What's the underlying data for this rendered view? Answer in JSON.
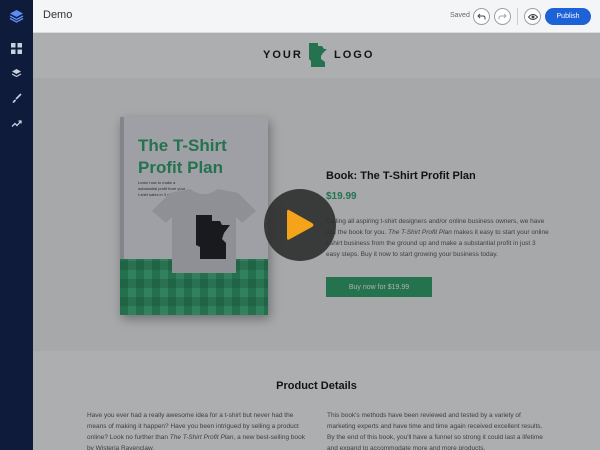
{
  "topbar": {
    "title": "Demo",
    "saved": "Saved",
    "publish": "Publish"
  },
  "rail": {
    "items": [
      {
        "icon": "grid-icon"
      },
      {
        "icon": "layers-icon"
      },
      {
        "icon": "brush-icon"
      },
      {
        "icon": "trend-icon"
      }
    ]
  },
  "brand": {
    "left": "YOUR",
    "right": "LOGO"
  },
  "product": {
    "title": "Book: The T-Shirt Profit Plan",
    "price": "$19.99",
    "description_1": "Calling all aspiring t-shirt designers and/or online business owners, we have just the book for you.",
    "description_em": "The T-Shirt Profit Plan",
    "description_2": "makes it easy to start your online t-shirt business from the ground up and make a substantial profit in just 3 easy steps. Buy it now to start growing your business today.",
    "buy_button": "Buy now for $19.99"
  },
  "book_cover": {
    "title_line1": "The T-Shirt",
    "title_line2": "Profit Plan",
    "subtitle_line1": "Learn how to make a",
    "subtitle_line2": "substantial profit from your",
    "subtitle_line3": "t-shirt sales in 3 easy steps"
  },
  "details": {
    "title": "Product Details",
    "left_1": "Have you ever had a really awesome idea for a t-shirt but never had the means of making it happen? Have you been intrigued by selling a product online? Look no further than",
    "left_em": "The T-Shirt Profit Plan",
    "left_2": ", a new best-selling book by Wisteria Ravenclaw.",
    "right": "This book's methods have been reviewed and tested by a variety of marketing experts and have time and time again received excellent results. By the end of this book, you'll have a funnel so strong it could last a lifetime and expand to accommodate more and more products."
  },
  "colors": {
    "accent": "#2fa36b",
    "publish": "#1e62d8",
    "rail": "#0f1b3a",
    "play": "#f4a31a"
  }
}
